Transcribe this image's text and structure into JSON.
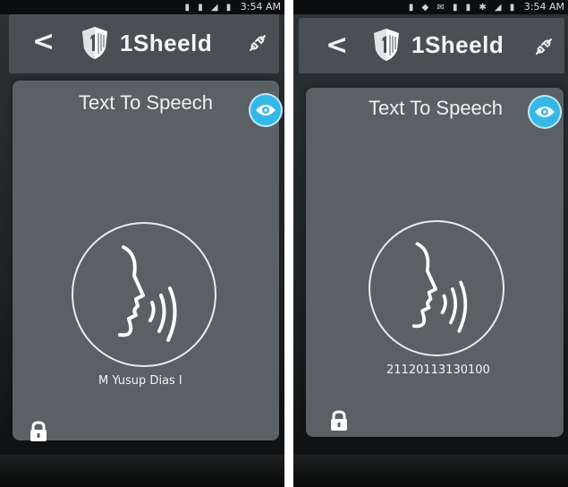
{
  "screens": [
    {
      "status_time": "3:54 AM",
      "app_name": "1Sheeld",
      "back_glyph": "<",
      "card_title": "Text To Speech",
      "spoken_text": "M Yusup Dias I",
      "icons": {
        "back": "back-arrow-icon",
        "logo": "shield-logo-icon",
        "plug": "plug-icon",
        "eye": "eye-icon",
        "speech": "speaking-head-icon",
        "lock": "lock-icon"
      }
    },
    {
      "status_time": "3:54 AM",
      "app_name": "1Sheeld",
      "back_glyph": "<",
      "card_title": "Text To Speech",
      "spoken_text": "21120113130100",
      "icons": {
        "back": "back-arrow-icon",
        "logo": "shield-logo-icon",
        "plug": "plug-icon",
        "eye": "eye-icon",
        "speech": "speaking-head-icon",
        "lock": "lock-icon"
      }
    }
  ],
  "colors": {
    "accent": "#35b8e8",
    "appbar": "#4a4f53",
    "card": "#5a6064",
    "text": "#eef0f1"
  }
}
